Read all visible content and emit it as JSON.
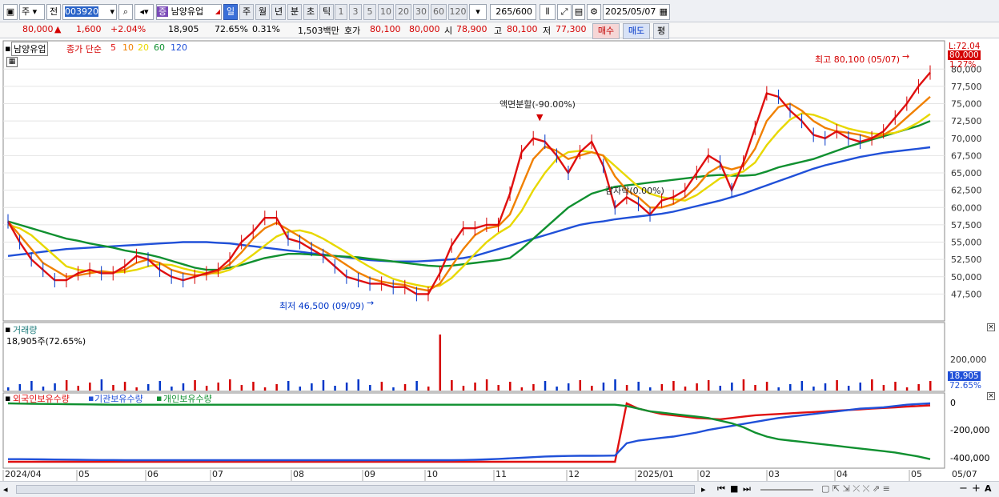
{
  "toolbar": {
    "market": "주",
    "scope": "전",
    "code": "003920",
    "stock_name": "남양유업",
    "stock_badge": "증",
    "periods": [
      "일",
      "주",
      "월",
      "년",
      "분",
      "초",
      "틱"
    ],
    "active_period": "일",
    "intervals": [
      "1",
      "3",
      "5",
      "10",
      "20",
      "30",
      "60",
      "120"
    ],
    "count": "265",
    "count_max": "/600",
    "date": "2025/05/07"
  },
  "quote": {
    "price": "80,000",
    "change": "1,600",
    "change_pct": "+2.04%",
    "volume": "18,905",
    "vol_ratio": "72.65%",
    "turnover": "0.31%",
    "amount": "1,503백만",
    "ask_label": "호가",
    "ask": "80,100",
    "bid": "80,000",
    "open_label": "시",
    "open": "78,900",
    "high_label": "고",
    "high": "80,100",
    "low_label": "저",
    "low": "77,300",
    "buy": "매수",
    "sell": "매도",
    "eval": "평"
  },
  "legend": {
    "name": "남양유업",
    "prefix": "종가 단순",
    "ma": [
      {
        "label": "5",
        "color": "#e01010"
      },
      {
        "label": "10",
        "color": "#f08000"
      },
      {
        "label": "20",
        "color": "#e8d800"
      },
      {
        "label": "60",
        "color": "#109030"
      },
      {
        "label": "120",
        "color": "#2050d8"
      }
    ]
  },
  "annotations": {
    "high": "최고 80,100 (05/07)",
    "low": "최저 46,500 (09/09)",
    "split": "액면분할(-90.00%)",
    "split2": "감자락(0.00%)",
    "last_price": "80,000",
    "last_pct": "1.27%",
    "top_corner": "L:72.04"
  },
  "volume_panel": {
    "title": "거래량",
    "info": "18,905주(72.65%)",
    "axis": "200,000",
    "tag_value": "18,905",
    "tag_pct": "72.65%"
  },
  "holding_panel": {
    "series": [
      "외국인보유수량",
      "기관보유수량",
      "개인보유수량"
    ],
    "axis": [
      "0",
      "-200,000",
      "-400,000"
    ]
  },
  "chart_data": {
    "type": "line",
    "title": "",
    "y_ticks": [
      "80,000",
      "77,500",
      "75,000",
      "72,500",
      "70,000",
      "67,500",
      "65,000",
      "62,500",
      "60,000",
      "57,500",
      "55,000",
      "52,500",
      "50,000",
      "47,500"
    ],
    "ylim": [
      45000,
      82000
    ],
    "x_ticks": [
      "2024/04",
      "05",
      "06",
      "07",
      "08",
      "09",
      "10",
      "11",
      "12",
      "2025/01",
      "02",
      "03",
      "04",
      "05",
      "05/07"
    ],
    "series": [
      {
        "name": "5",
        "color": "#e01010",
        "values": [
          58000,
          55000,
          52500,
          51000,
          49500,
          49500,
          50500,
          51000,
          50500,
          50500,
          51500,
          53000,
          52500,
          51000,
          50000,
          49500,
          50000,
          50500,
          51000,
          52500,
          55000,
          56500,
          58500,
          58500,
          55500,
          55000,
          54000,
          53000,
          51500,
          50000,
          49500,
          49000,
          49000,
          48500,
          48500,
          47500,
          47500,
          50500,
          54500,
          57000,
          57000,
          57500,
          57500,
          62000,
          68000,
          70000,
          69500,
          67500,
          65000,
          68000,
          69500,
          66000,
          60000,
          61500,
          60500,
          59000,
          61000,
          61500,
          62500,
          65000,
          67500,
          66500,
          62500,
          66500,
          71500,
          76500,
          76000,
          74000,
          72500,
          70500,
          70000,
          71000,
          70000,
          69500,
          70000,
          71000,
          73000,
          75000,
          77500,
          79500
        ]
      },
      {
        "name": "10",
        "color": "#f08000",
        "values": [
          58000,
          56000,
          54000,
          52000,
          51000,
          50000,
          50200,
          50500,
          50800,
          50600,
          51000,
          52000,
          52500,
          52000,
          51000,
          50500,
          50200,
          50300,
          50800,
          51800,
          53500,
          55500,
          57000,
          57800,
          56800,
          55800,
          54700,
          53800,
          52800,
          51700,
          50600,
          49800,
          49300,
          49000,
          48800,
          48300,
          48000,
          49000,
          51500,
          54000,
          56000,
          57000,
          57300,
          59000,
          63000,
          67000,
          68800,
          68200,
          67000,
          67500,
          68000,
          67500,
          64500,
          62500,
          61500,
          60000,
          60000,
          60500,
          61500,
          63000,
          65000,
          66000,
          65500,
          66000,
          68500,
          72500,
          74500,
          75000,
          74000,
          72500,
          71500,
          71000,
          70800,
          70500,
          70000,
          70500,
          71500,
          73000,
          74500,
          76000
        ]
      },
      {
        "name": "20",
        "color": "#e8d800",
        "values": [
          57500,
          57000,
          56000,
          54500,
          53000,
          51500,
          51000,
          50800,
          50700,
          50600,
          50700,
          51000,
          51500,
          51800,
          51700,
          51200,
          50800,
          50500,
          50500,
          51000,
          52000,
          53200,
          54500,
          55800,
          56500,
          56700,
          56300,
          55500,
          54500,
          53500,
          52400,
          51400,
          50500,
          49700,
          49200,
          48800,
          48500,
          48700,
          49800,
          51500,
          53300,
          55000,
          56300,
          57300,
          59500,
          62500,
          65000,
          67000,
          68000,
          68200,
          68000,
          67500,
          66000,
          64500,
          63000,
          62000,
          61500,
          61200,
          61000,
          61800,
          63000,
          64200,
          64700,
          65200,
          66500,
          69000,
          71000,
          72700,
          73600,
          73400,
          72800,
          72000,
          71400,
          71000,
          70700,
          70600,
          70800,
          71400,
          72300,
          73500
        ]
      },
      {
        "name": "60",
        "color": "#109030",
        "values": [
          58000,
          57500,
          57000,
          56500,
          56000,
          55500,
          55200,
          54800,
          54500,
          54200,
          53800,
          53500,
          53200,
          52800,
          52300,
          51800,
          51300,
          51000,
          51000,
          51300,
          51700,
          52200,
          52700,
          53000,
          53300,
          53300,
          53200,
          53100,
          53000,
          52900,
          52800,
          52600,
          52400,
          52200,
          52000,
          51800,
          51600,
          51500,
          51600,
          51800,
          52000,
          52200,
          52400,
          52700,
          54000,
          55500,
          57000,
          58500,
          60000,
          61000,
          62000,
          62500,
          63000,
          63200,
          63400,
          63600,
          63800,
          64000,
          64200,
          64400,
          64600,
          64700,
          64600,
          64600,
          64700,
          65200,
          65800,
          66200,
          66600,
          67000,
          67600,
          68200,
          68800,
          69300,
          69800,
          70300,
          70800,
          71300,
          71800,
          72500
        ]
      },
      {
        "name": "120",
        "color": "#2050d8",
        "values": [
          53000,
          53200,
          53400,
          53600,
          53800,
          54000,
          54100,
          54200,
          54300,
          54400,
          54500,
          54600,
          54700,
          54800,
          54900,
          55000,
          55000,
          55000,
          54900,
          54800,
          54600,
          54400,
          54200,
          54000,
          53800,
          53600,
          53400,
          53200,
          53000,
          52800,
          52600,
          52400,
          52300,
          52200,
          52200,
          52200,
          52300,
          52400,
          52500,
          52700,
          53000,
          53500,
          54000,
          54500,
          55000,
          55500,
          56000,
          56500,
          57000,
          57500,
          57800,
          58000,
          58300,
          58500,
          58700,
          58900,
          59100,
          59400,
          59800,
          60200,
          60600,
          61000,
          61500,
          62000,
          62600,
          63200,
          63800,
          64400,
          65000,
          65600,
          66100,
          66500,
          66900,
          67300,
          67600,
          67900,
          68100,
          68300,
          68500,
          68700
        ]
      }
    ],
    "holdings": [
      {
        "name": "외국인보유수량",
        "color": "#e01010",
        "values": [
          -440000,
          -440000,
          -440000,
          -440000,
          -440000,
          -440000,
          -440000,
          -440000,
          -440000,
          -440000,
          -440000,
          -440000,
          -440000,
          -440000,
          -440000,
          -440000,
          -440000,
          -440000,
          -440000,
          -440000,
          -440000,
          -440000,
          -440000,
          -440000,
          -440000,
          -440000,
          -440000,
          -440000,
          -440000,
          -440000,
          -440000,
          -440000,
          -440000,
          -440000,
          -440000,
          -440000,
          -440000,
          -440000,
          -440000,
          -440000,
          -440000,
          -440000,
          -440000,
          -440000,
          -440000,
          -440000,
          -440000,
          -440000,
          -440000,
          -440000,
          -440000,
          -440000,
          -440000,
          0,
          -40000,
          -60000,
          -80000,
          -90000,
          -100000,
          -110000,
          -115000,
          -120000,
          -110000,
          -100000,
          -90000,
          -85000,
          -80000,
          -75000,
          -70000,
          -65000,
          -60000,
          -55000,
          -50000,
          -45000,
          -40000,
          -35000,
          -30000,
          -25000,
          -20000,
          -15000
        ]
      },
      {
        "name": "기관보유수량",
        "color": "#2050d8",
        "values": [
          -420000,
          -420000,
          -421000,
          -422000,
          -423000,
          -424000,
          -425000,
          -426000,
          -427000,
          -427000,
          -428000,
          -428000,
          -428000,
          -428000,
          -428000,
          -428000,
          -428000,
          -428000,
          -428000,
          -428000,
          -428000,
          -428000,
          -428000,
          -428000,
          -428000,
          -428000,
          -428000,
          -428000,
          -428000,
          -428000,
          -428000,
          -428000,
          -428000,
          -428000,
          -428000,
          -428000,
          -428000,
          -428000,
          -428000,
          -427000,
          -425000,
          -422000,
          -418000,
          -414000,
          -410000,
          -405000,
          -400000,
          -398000,
          -396000,
          -395000,
          -395000,
          -394000,
          -393000,
          -300000,
          -280000,
          -270000,
          -260000,
          -250000,
          -235000,
          -220000,
          -200000,
          -185000,
          -170000,
          -155000,
          -140000,
          -125000,
          -110000,
          -100000,
          -90000,
          -80000,
          -70000,
          -60000,
          -50000,
          -40000,
          -35000,
          -30000,
          -20000,
          -10000,
          -5000,
          0
        ]
      },
      {
        "name": "개인보유수량",
        "color": "#109030",
        "values": [
          0,
          -2000,
          -3000,
          -4000,
          -5000,
          -6000,
          -7000,
          -8000,
          -9000,
          -10000,
          -10000,
          -10000,
          -10000,
          -10000,
          -10000,
          -10000,
          -10000,
          -10000,
          -10000,
          -10000,
          -10000,
          -10000,
          -10000,
          -10000,
          -10000,
          -10000,
          -10000,
          -10000,
          -10000,
          -10000,
          -10000,
          -10000,
          -10000,
          -10000,
          -10000,
          -10000,
          -10000,
          -10000,
          -10000,
          -10000,
          -10000,
          -10000,
          -10000,
          -10000,
          -10000,
          -10000,
          -10000,
          -10000,
          -10000,
          -10000,
          -10000,
          -10000,
          -10000,
          -20000,
          -40000,
          -60000,
          -70000,
          -80000,
          -90000,
          -100000,
          -110000,
          -130000,
          -150000,
          -180000,
          -220000,
          -250000,
          -270000,
          -280000,
          -290000,
          -300000,
          -310000,
          -320000,
          -330000,
          -340000,
          -350000,
          -360000,
          -370000,
          -385000,
          -400000,
          -420000
        ]
      }
    ]
  },
  "statusbar": {
    "controls": [
      "▶",
      "⏮",
      "■",
      "⏭"
    ]
  }
}
